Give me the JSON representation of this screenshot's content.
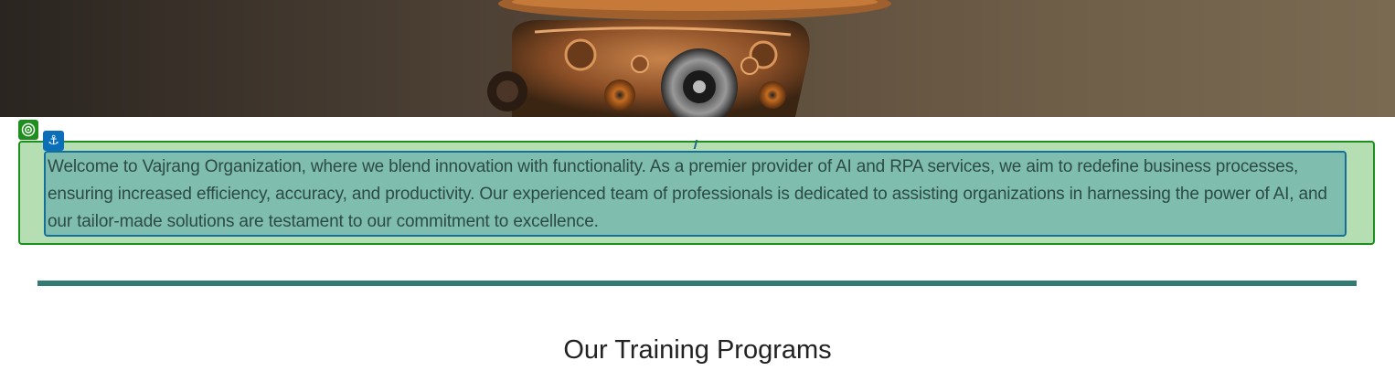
{
  "hero": {
    "image_description_icon": "robot-hero-image"
  },
  "builder": {
    "section_handle_icon": "target-icon",
    "anchor_handle_icon": "anchor-icon",
    "anchor_glyph": "⚓"
  },
  "intro": {
    "paragraph": "Welcome to Vajrang Organization, where we blend innovation with functionality. As a premier provider of AI and RPA services, we aim to redefine business processes, ensuring increased efficiency, accuracy, and productivity. Our experienced team of professionals is dedicated to assisting organizations in harnessing the power of AI, and our tailor-made solutions are testament to our commitment to excellence."
  },
  "programs": {
    "heading": "Our Training Programs"
  },
  "colors": {
    "section_outline": "#1e8e1e",
    "section_fill": "#b5dfb3",
    "text_outline": "#14709a",
    "text_fill": "#7fbeaf",
    "divider": "#327a72"
  }
}
